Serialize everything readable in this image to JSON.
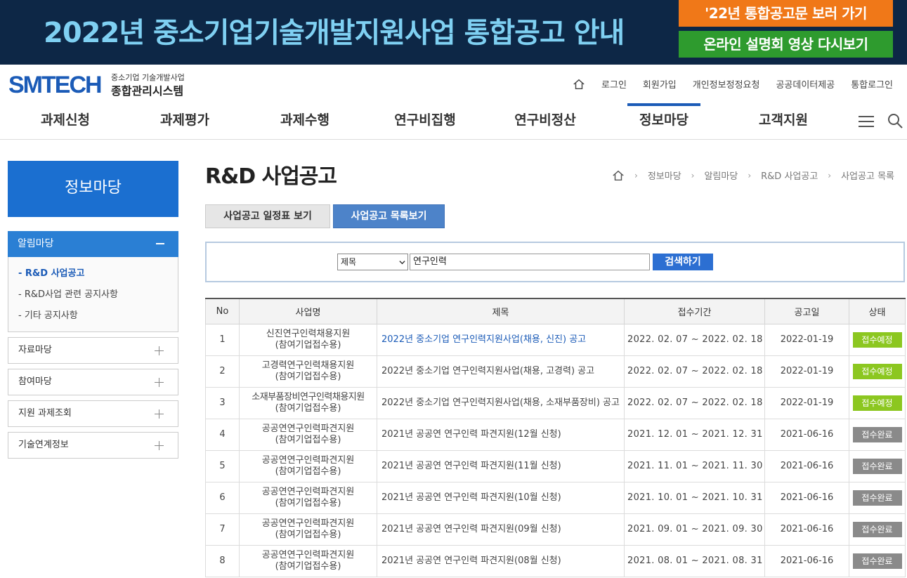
{
  "banner": {
    "title": "2022년 중소기업기술개발지원사업 통합공고 안내",
    "btn_notice": "'22년 통합공고문 보러 가기",
    "btn_video": "온라인 설명회 영상 다시보기"
  },
  "logo": {
    "main": "SMTECH",
    "sub1": "중소기업 기술개발사업",
    "sub2": "종합관리시스템"
  },
  "util": {
    "login": "로그인",
    "join": "회원가입",
    "privacy": "개인정보정정요청",
    "public_data": "공공데이터제공",
    "sso": "통합로그인"
  },
  "gnb": [
    "과제신청",
    "과제평가",
    "과제수행",
    "연구비집행",
    "연구비정산",
    "정보마당",
    "고객지원"
  ],
  "sidebar": {
    "title": "정보마당",
    "active_group": "알림마당",
    "sub_items": [
      "- R&D 사업공고",
      "- R&D사업 관련 공지사항",
      "- 기타 공지사항"
    ],
    "groups": [
      "자료마당",
      "참여마당",
      "지원 과제조회",
      "기술연계정보"
    ]
  },
  "content": {
    "title": "R&D 사업공고",
    "breadcrumb": [
      "정보마당",
      "알림마당",
      "R&D 사업공고",
      "사업공고 목록"
    ],
    "tab_schedule": "사업공고 일정표 보기",
    "tab_list": "사업공고 목록보기"
  },
  "search": {
    "field": "제목",
    "query": "연구인력",
    "button": "검색하기"
  },
  "table": {
    "headers": [
      "No",
      "사업명",
      "제목",
      "접수기간",
      "공고일",
      "상태"
    ],
    "rows": [
      {
        "no": "1",
        "biz1": "신진연구인력채용지원",
        "biz2": "(참여기업접수용)",
        "title": "2022년 중소기업 연구인력지원사업(채용, 신진) 공고",
        "period": "2022. 02. 07 ~ 2022. 02. 18",
        "date": "2022-01-19",
        "status": "접수예정"
      },
      {
        "no": "2",
        "biz1": "고경력연구인력채용지원",
        "biz2": "(참여기업접수용)",
        "title": "2022년 중소기업 연구인력지원사업(채용, 고경력) 공고",
        "period": "2022. 02. 07 ~ 2022. 02. 18",
        "date": "2022-01-19",
        "status": "접수예정"
      },
      {
        "no": "3",
        "biz1": "소재부품장비연구인력채용지원",
        "biz2": "(참여기업접수용)",
        "title": "2022년 중소기업 연구인력지원사업(채용, 소재부품장비) 공고",
        "period": "2022. 02. 07 ~ 2022. 02. 18",
        "date": "2022-01-19",
        "status": "접수예정"
      },
      {
        "no": "4",
        "biz1": "공공연연구인력파견지원",
        "biz2": "(참여기업접수용)",
        "title": "2021년 공공연 연구인력 파견지원(12월 신청)",
        "period": "2021. 12. 01 ~ 2021. 12. 31",
        "date": "2021-06-16",
        "status": "접수완료"
      },
      {
        "no": "5",
        "biz1": "공공연연구인력파견지원",
        "biz2": "(참여기업접수용)",
        "title": "2021년 공공연 연구인력 파견지원(11월 신청)",
        "period": "2021. 11. 01 ~ 2021. 11. 30",
        "date": "2021-06-16",
        "status": "접수완료"
      },
      {
        "no": "6",
        "biz1": "공공연연구인력파견지원",
        "biz2": "(참여기업접수용)",
        "title": "2021년 공공연 연구인력 파견지원(10월 신청)",
        "period": "2021. 10. 01 ~ 2021. 10. 31",
        "date": "2021-06-16",
        "status": "접수완료"
      },
      {
        "no": "7",
        "biz1": "공공연연구인력파견지원",
        "biz2": "(참여기업접수용)",
        "title": "2021년 공공연 연구인력 파견지원(09월 신청)",
        "period": "2021. 09. 01 ~ 2021. 09. 30",
        "date": "2021-06-16",
        "status": "접수완료"
      },
      {
        "no": "8",
        "biz1": "공공연연구인력파견지원",
        "biz2": "(참여기업접수용)",
        "title": "2021년 공공연 연구인력 파견지원(08월 신청)",
        "period": "2021. 08. 01 ~ 2021. 08. 31",
        "date": "2021-06-16",
        "status": "접수완료"
      }
    ]
  },
  "colors": {
    "brand": "#1b5bb7",
    "banner_bg": "#0d2746",
    "status_planned": "#8cc720",
    "status_done": "#8a8a8a"
  }
}
